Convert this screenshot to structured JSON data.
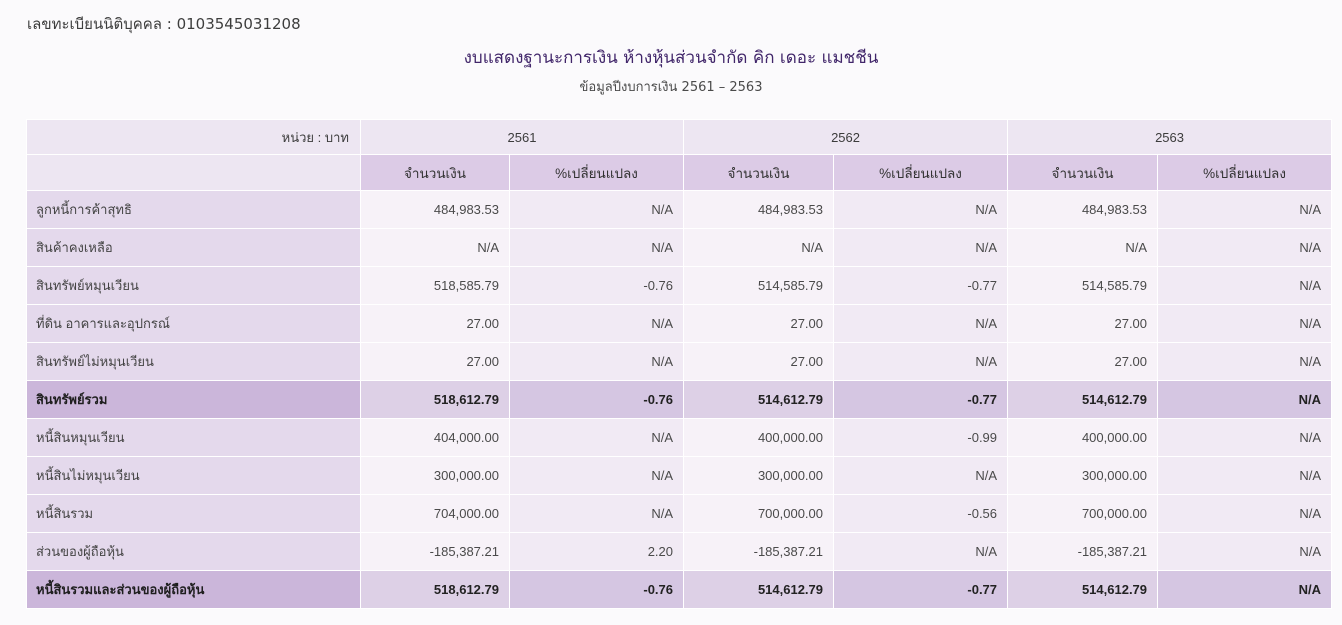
{
  "registration": "เลขทะเบียนนิติบุคคล : 0103545031208",
  "title": "งบแสดงฐานะการเงิน ห้างหุ้นส่วนจำกัด คิก เดอะ แมชชีน",
  "subtitle": "ข้อมูลปีงบการเงิน 2561 – 2563",
  "table": {
    "unit_label": "หน่วย : บาท",
    "years": [
      "2561",
      "2562",
      "2563"
    ],
    "amount_header": "จำนวนเงิน",
    "change_header": "%เปลี่ยนแปลง",
    "rows": [
      {
        "label": "ลูกหนี้การค้าสุทธิ",
        "cells": [
          "484,983.53",
          "N/A",
          "484,983.53",
          "N/A",
          "484,983.53",
          "N/A"
        ]
      },
      {
        "label": "สินค้าคงเหลือ",
        "cells": [
          "N/A",
          "N/A",
          "N/A",
          "N/A",
          "N/A",
          "N/A"
        ]
      },
      {
        "label": "สินทรัพย์หมุนเวียน",
        "cells": [
          "518,585.79",
          "-0.76",
          "514,585.79",
          "-0.77",
          "514,585.79",
          "N/A"
        ]
      },
      {
        "label": "ที่ดิน อาคารและอุปกรณ์",
        "cells": [
          "27.00",
          "N/A",
          "27.00",
          "N/A",
          "27.00",
          "N/A"
        ]
      },
      {
        "label": "สินทรัพย์ไม่หมุนเวียน",
        "cells": [
          "27.00",
          "N/A",
          "27.00",
          "N/A",
          "27.00",
          "N/A"
        ]
      },
      {
        "label": "สินทรัพย์รวม",
        "cells": [
          "518,612.79",
          "-0.76",
          "514,612.79",
          "-0.77",
          "514,612.79",
          "N/A"
        ]
      },
      {
        "label": "หนี้สินหมุนเวียน",
        "cells": [
          "404,000.00",
          "N/A",
          "400,000.00",
          "-0.99",
          "400,000.00",
          "N/A"
        ]
      },
      {
        "label": "หนี้สินไม่หมุนเวียน",
        "cells": [
          "300,000.00",
          "N/A",
          "300,000.00",
          "N/A",
          "300,000.00",
          "N/A"
        ]
      },
      {
        "label": "หนี้สินรวม",
        "cells": [
          "704,000.00",
          "N/A",
          "700,000.00",
          "-0.56",
          "700,000.00",
          "N/A"
        ]
      },
      {
        "label": "ส่วนของผู้ถือหุ้น",
        "cells": [
          "-185,387.21",
          "2.20",
          "-185,387.21",
          "N/A",
          "-185,387.21",
          "N/A"
        ]
      },
      {
        "label": "หนี้สินรวมและส่วนของผู้ถือหุ้น",
        "cells": [
          "518,612.79",
          "-0.76",
          "514,612.79",
          "-0.77",
          "514,612.79",
          "N/A"
        ]
      }
    ]
  }
}
